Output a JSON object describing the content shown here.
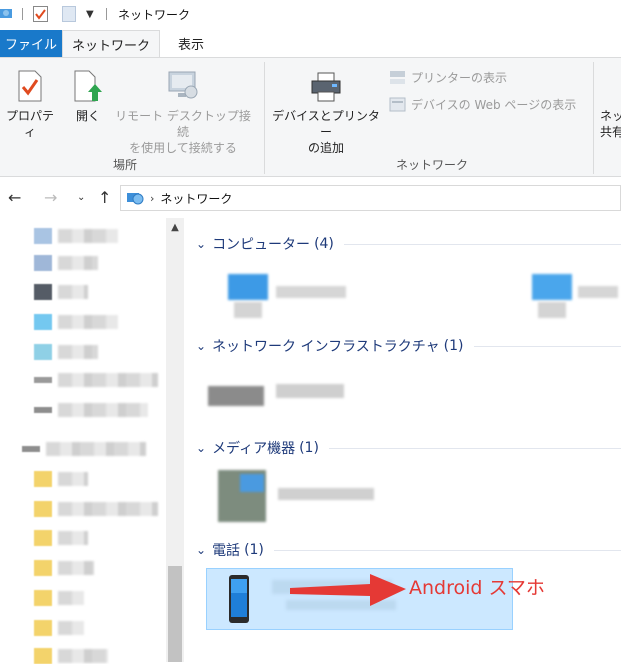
{
  "window": {
    "title": "ネットワーク"
  },
  "ribbon": {
    "tabs": {
      "file": "ファイル",
      "network": "ネットワーク",
      "view": "表示"
    },
    "location_group": {
      "label": "場所",
      "properties": "プロパティ",
      "open": "開く",
      "remote_line1": "リモート デスクトップ接続",
      "remote_line2": "を使用して接続する"
    },
    "network_group": {
      "label": "ネットワーク",
      "add_devices_line1": "デバイスとプリンター",
      "add_devices_line2": "の追加",
      "view_printers": "プリンターの表示",
      "view_web_page": "デバイスの Web ページの表示"
    },
    "cut_group": {
      "line1": "ネッ",
      "line2": "共有"
    }
  },
  "address": {
    "path": "ネットワーク"
  },
  "groups": [
    {
      "title": "コンピューター",
      "count": "(4)"
    },
    {
      "title": "ネットワーク インフラストラクチャ",
      "count": "(1)"
    },
    {
      "title": "メディア機器",
      "count": "(1)"
    },
    {
      "title": "電話",
      "count": "(1)"
    }
  ],
  "annotation": {
    "text": "Android スマホ",
    "color": "#e53935"
  },
  "colors": {
    "accent": "#1979ca",
    "group_title": "#1e3a7a",
    "selection": "#cce8ff"
  }
}
